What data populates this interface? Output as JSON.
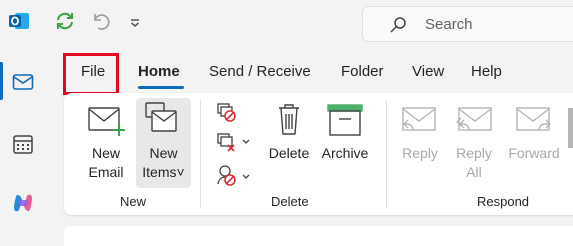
{
  "titlebar": {
    "app_icon": "outlook-logo-icon",
    "quick_access": [
      "sync-icon",
      "undo-icon",
      "customize-dropdown-icon"
    ],
    "search": {
      "placeholder": "Search",
      "icon": "search-icon"
    }
  },
  "rail": {
    "items": [
      {
        "name": "mail",
        "icon": "mail-icon",
        "active": true
      },
      {
        "name": "calendar",
        "icon": "calendar-icon",
        "active": false
      },
      {
        "name": "copilot",
        "icon": "copilot-icon",
        "active": false
      }
    ]
  },
  "tabs": [
    {
      "label": "File",
      "active": false,
      "highlighted": true
    },
    {
      "label": "Home",
      "active": true
    },
    {
      "label": "Send / Receive",
      "active": false
    },
    {
      "label": "Folder",
      "active": false
    },
    {
      "label": "View",
      "active": false
    },
    {
      "label": "Help",
      "active": false
    }
  ],
  "ribbon": {
    "groups": {
      "new": "New",
      "delete": "Delete",
      "respond": "Respond"
    },
    "new_email": {
      "line1": "New",
      "line2": "Email",
      "icon": "new-email-icon"
    },
    "new_items": {
      "line1": "New",
      "line2": "Items",
      "icon": "new-items-icon",
      "chevron": "˅"
    },
    "ignore_icon": "ignore-icon",
    "cleanup_icon": "clean-up-icon",
    "junk_icon": "junk-icon",
    "delete": {
      "label": "Delete",
      "icon": "delete-icon"
    },
    "archive": {
      "label": "Archive",
      "icon": "archive-icon"
    },
    "reply": {
      "label": "Reply",
      "icon": "reply-icon",
      "enabled": false
    },
    "reply_all": {
      "line1": "Reply",
      "line2": "All",
      "icon": "reply-all-icon",
      "enabled": false
    },
    "forward": {
      "label": "Forward",
      "icon": "forward-icon",
      "enabled": false
    }
  },
  "colors": {
    "accent": "#0f6cbd",
    "highlight_box": "#e0081f",
    "disabled_text": "#a8a8a8",
    "sync_green": "#3aa33f",
    "archive_green": "#4caf6a"
  }
}
